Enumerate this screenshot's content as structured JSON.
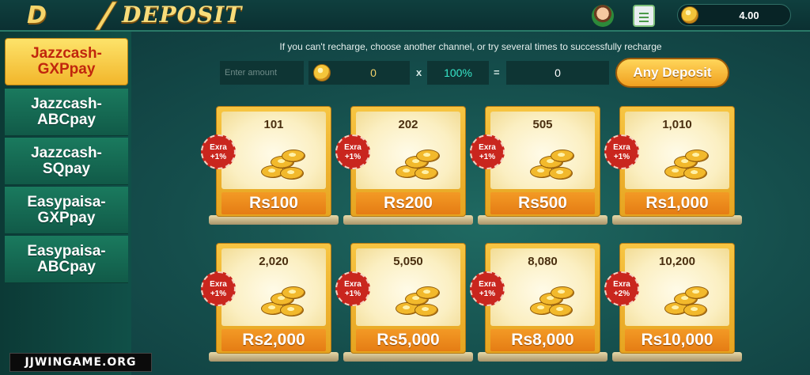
{
  "header": {
    "logo_text": "D",
    "title": "DEPOSIT",
    "balance": "4.00"
  },
  "sidebar": {
    "items": [
      {
        "label": "Jazzcash-\nGXPpay",
        "active": true
      },
      {
        "label": "Jazzcash-\nABCpay",
        "active": false
      },
      {
        "label": "Jazzcash-\nSQpay",
        "active": false
      },
      {
        "label": "Easypaisa-\nGXPpay",
        "active": false
      },
      {
        "label": "Easypaisa-\nABCpay",
        "active": false
      }
    ]
  },
  "deposit": {
    "hint": "If you can't recharge, choose another channel, or try several times to successfully recharge",
    "amount_placeholder": "Enter amount",
    "coin_amount": "0",
    "multiply_sign": "x",
    "rate": "100%",
    "equals_sign": "=",
    "result": "0",
    "any_deposit_label": "Any Deposit"
  },
  "packages": [
    {
      "coins": "101",
      "bonus_line1": "Exra",
      "bonus_line2": "+1%",
      "price": "Rs100"
    },
    {
      "coins": "202",
      "bonus_line1": "Exra",
      "bonus_line2": "+1%",
      "price": "Rs200"
    },
    {
      "coins": "505",
      "bonus_line1": "Exra",
      "bonus_line2": "+1%",
      "price": "Rs500"
    },
    {
      "coins": "1,010",
      "bonus_line1": "Exra",
      "bonus_line2": "+1%",
      "price": "Rs1,000"
    },
    {
      "coins": "2,020",
      "bonus_line1": "Exra",
      "bonus_line2": "+1%",
      "price": "Rs2,000"
    },
    {
      "coins": "5,050",
      "bonus_line1": "Exra",
      "bonus_line2": "+1%",
      "price": "Rs5,000"
    },
    {
      "coins": "8,080",
      "bonus_line1": "Exra",
      "bonus_line2": "+1%",
      "price": "Rs8,000"
    },
    {
      "coins": "10,200",
      "bonus_line1": "Exra",
      "bonus_line2": "+2%",
      "price": "Rs10,000"
    }
  ],
  "watermark": "JJWINGAME.ORG",
  "colors": {
    "accent_gold": "#f2b62b",
    "active_text": "#c1260d",
    "rate_teal": "#37e6c9",
    "badge_red": "#c9261e",
    "background": "#154e4c"
  }
}
